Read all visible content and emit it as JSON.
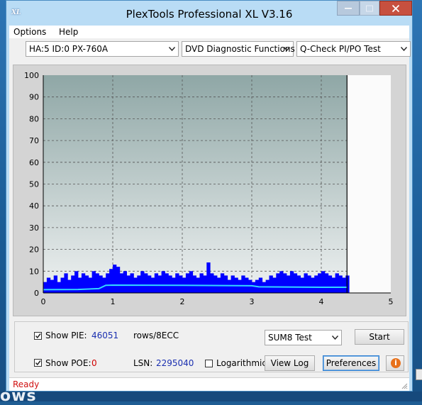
{
  "window": {
    "title": "PlexTools Professional XL V3.16",
    "icon_label": "XL"
  },
  "desktop": {
    "bottom_text": "ows"
  },
  "menu": {
    "options": "Options",
    "help": "Help"
  },
  "toolbar": {
    "drive": "HA:5 ID:0  PX-760A",
    "function": "DVD Diagnostic Functions",
    "test": "Q-Check PI/PO Test"
  },
  "chart_data": {
    "type": "bar",
    "title": "",
    "xlabel": "",
    "ylabel": "",
    "xlim": [
      0,
      5
    ],
    "ylim": [
      0,
      100
    ],
    "x_ticks": [
      "0",
      "1",
      "2",
      "3",
      "4",
      "5"
    ],
    "y_ticks": [
      "0",
      "10",
      "20",
      "30",
      "40",
      "50",
      "60",
      "70",
      "80",
      "90",
      "100"
    ],
    "grid": true,
    "end_marker_x": 4.37,
    "series": [
      {
        "type": "bar",
        "color": "#0000ff",
        "x": [
          0.0,
          0.05,
          0.1,
          0.15,
          0.2,
          0.25,
          0.3,
          0.35,
          0.4,
          0.45,
          0.5,
          0.55,
          0.6,
          0.65,
          0.7,
          0.75,
          0.8,
          0.85,
          0.9,
          0.95,
          1.0,
          1.05,
          1.1,
          1.15,
          1.2,
          1.25,
          1.3,
          1.35,
          1.4,
          1.45,
          1.5,
          1.55,
          1.6,
          1.65,
          1.7,
          1.75,
          1.8,
          1.85,
          1.9,
          1.95,
          2.0,
          2.05,
          2.1,
          2.15,
          2.2,
          2.25,
          2.3,
          2.35,
          2.4,
          2.45,
          2.5,
          2.55,
          2.6,
          2.65,
          2.7,
          2.75,
          2.8,
          2.85,
          2.9,
          2.95,
          3.0,
          3.05,
          3.1,
          3.15,
          3.2,
          3.25,
          3.3,
          3.35,
          3.4,
          3.45,
          3.5,
          3.55,
          3.6,
          3.65,
          3.7,
          3.75,
          3.8,
          3.85,
          3.9,
          3.95,
          4.0,
          4.05,
          4.1,
          4.15,
          4.2,
          4.25,
          4.3,
          4.35
        ],
        "values": [
          5,
          7,
          6,
          8,
          5,
          7,
          9,
          6,
          8,
          10,
          7,
          9,
          8,
          7,
          10,
          9,
          8,
          7,
          9,
          11,
          13,
          12,
          9,
          10,
          8,
          9,
          7,
          8,
          10,
          9,
          8,
          7,
          9,
          8,
          10,
          9,
          8,
          7,
          9,
          8,
          7,
          9,
          10,
          8,
          7,
          9,
          8,
          14,
          9,
          8,
          7,
          9,
          8,
          6,
          8,
          7,
          6,
          8,
          7,
          6,
          5,
          6,
          7,
          5,
          6,
          8,
          7,
          9,
          10,
          9,
          8,
          10,
          9,
          8,
          7,
          9,
          8,
          7,
          8,
          9,
          10,
          9,
          8,
          7,
          9,
          8,
          7,
          8
        ]
      },
      {
        "type": "line",
        "color": "#33d6ff",
        "x": [
          0,
          0.5,
          0.8,
          0.9,
          1.0,
          2.0,
          3.0,
          3.1,
          4.0,
          4.37
        ],
        "values": [
          1.5,
          1.6,
          2.0,
          3.5,
          3.6,
          3.5,
          3.3,
          2.8,
          2.6,
          2.6
        ]
      }
    ]
  },
  "controls": {
    "show_pie_label": "Show PIE:",
    "pie_value": "46051",
    "rows_label": "rows/8ECC",
    "show_poe_label": "Show POE:",
    "poe_value": "0",
    "lsn_label": "LSN:",
    "lsn_value": "2295040",
    "logarithmic_label": "Logarithmic",
    "test_select": "SUM8 Test",
    "start_label": "Start",
    "view_log_label": "View Log",
    "preferences_label": "Preferences"
  },
  "status": {
    "text": "Ready"
  }
}
